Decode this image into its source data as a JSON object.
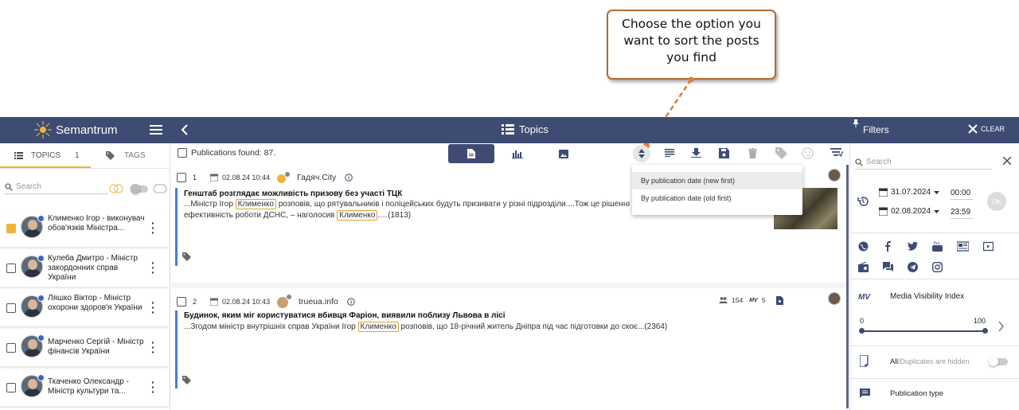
{
  "callout": {
    "line1": "Choose the option you",
    "line2": "want to sort the posts",
    "line3": "you find"
  },
  "header": {
    "brand": "Semantrum",
    "title": "Topics",
    "filters": "Filters",
    "clear": "CLEAR"
  },
  "left": {
    "tab_topics": "TOPICS",
    "topics_count": "1",
    "tab_tags": "TAGS",
    "search_placeholder": "Search",
    "topics": [
      {
        "label": "Клименко Ігор - виконувач обов'язків Міністра...",
        "checked": true
      },
      {
        "label": "Кулеба Дмитро - Міністр закордонних справ України",
        "checked": false
      },
      {
        "label": "Ляшко Віктор - Міністр охорони здоров'я України",
        "checked": false
      },
      {
        "label": "Марченко Сергій - Міністр фінансів України",
        "checked": false
      },
      {
        "label": "Ткаченко Олександр - Міністр культури та...",
        "checked": false
      }
    ]
  },
  "center": {
    "pub_found": "Publications found: 87.",
    "sort_options": [
      "By publication date (new first)",
      "By publication date (old first)"
    ],
    "posts": [
      {
        "num": "1",
        "date": "02.08.24 10:44",
        "source": "Гадяч.City",
        "title": "Генштаб розглядає можливість призову без участі ТЦК",
        "body_pre": "...Міністр Ігор ",
        "hl1": "Клименко",
        "body_mid": " розповів, що рятувальників і поліцейських будуть призивати у різні підрозділи....Тож це рішення підвищить",
        "body2_pre": "ефективність роботи ДСНС, – наголосив ",
        "hl2": "Клименко",
        "body2_post": ".…(1813)"
      },
      {
        "num": "2",
        "date": "02.08.24 10:43",
        "source": "trueua.info",
        "stat1": "154",
        "stat2": "5",
        "mv": "MV",
        "title": "Будинок, яким міг користуватися вбивця Фаріон, виявили поблизу Львова в лісі",
        "body_pre": "...Згодом міністр внутрішніх справ України Ігор ",
        "hl1": "Клименко",
        "body_mid": " розповів, що 18-річний житель Дніпра під час підготовки до скоє...(2364)"
      }
    ]
  },
  "right": {
    "search_placeholder": "Search",
    "date_from": "31.07.2024",
    "time_from": "00:00",
    "date_to": "02.08.2024",
    "time_to": "23:59",
    "ok": "OK",
    "mv": "MV",
    "mvi_label": "Media Visibility Index",
    "mvi_min": "0",
    "mvi_max": "100",
    "dup_all": "All",
    "dup_rest": "/Duplicates are hidden",
    "pub_type": "Publication type"
  },
  "colors": {
    "nav": "#3e4b73",
    "accent": "#f0b43a",
    "bar": "#4a7bd8",
    "callout_border": "#b86a2c"
  }
}
